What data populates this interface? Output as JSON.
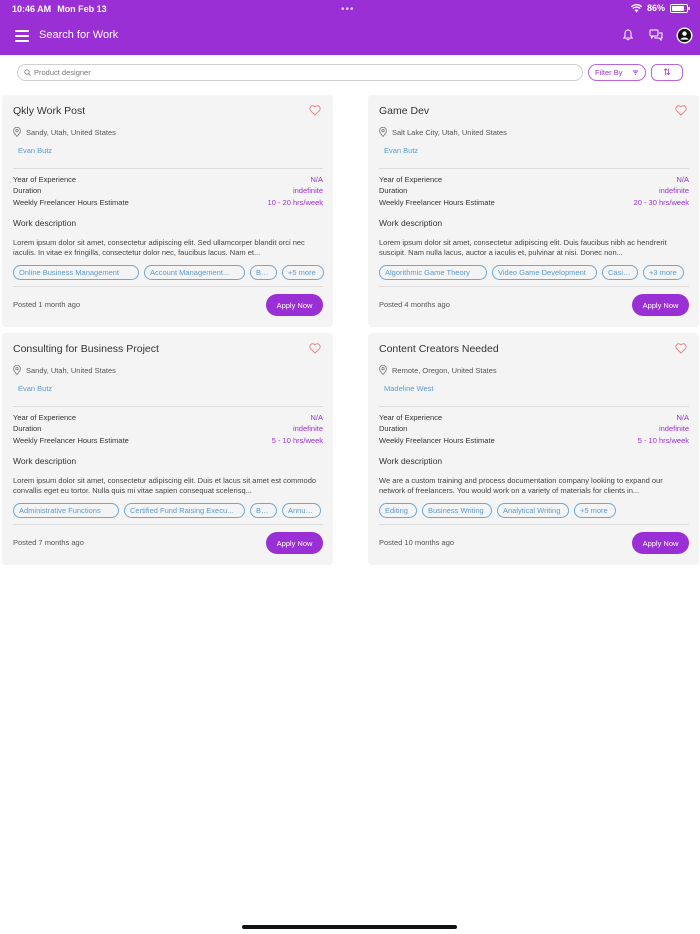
{
  "status_bar": {
    "time": "10:46 AM",
    "date": "Mon Feb 13",
    "battery": "86%"
  },
  "navbar": {
    "title": "Search for Work"
  },
  "search": {
    "placeholder": "Product designer",
    "filter_label": "Filter By",
    "sort_label": "⇅"
  },
  "colors": {
    "brand": "#9b2fd6",
    "link": "#5b9bd1",
    "card_bg": "#f4f4f4"
  },
  "labels": {
    "experience": "Year of Experience",
    "duration": "Duration",
    "hours": "Weekly Freelancer Hours Estimate",
    "work_description": "Work description",
    "apply": "Apply Now"
  },
  "jobs": [
    {
      "title": "Qkly Work Post",
      "location": "Sandy, Utah, United States",
      "poster": "Evan Butz",
      "experience": "N/A",
      "duration": "indefinite",
      "hours": "10 - 20 hrs/week",
      "description": "Lorem ipsum dolor sit amet, consectetur adipiscing elit. Sed ullamcorper blandit orci nec iaculis. In vitae ex fringilla, consectetur dolor nec, faucibus lacus. Nam et...",
      "tags": [
        "Online Business Management",
        "Account Management...",
        "Busi...",
        "+5 more"
      ],
      "posted": "Posted 1 month ago"
    },
    {
      "title": "Game Dev",
      "location": "Salt Lake City, Utah, United States",
      "poster": "Evan Butz",
      "experience": "N/A",
      "duration": "indefinite",
      "hours": "20 - 30 hrs/week",
      "description": "Lorem ipsum dolor sit amet, consectetur adipiscing elit. Duis faucibus nibh ac hendrerit suscipit. Nam nulla lacus, auctor a iaculis et, pulvinar at nisi. Donec non...",
      "tags": [
        "Algorithmic Game Theory",
        "Video Game Development",
        "Casino...",
        "+3 more"
      ],
      "posted": "Posted 4 months ago"
    },
    {
      "title": "Consulting for Business Project",
      "location": "Sandy, Utah, United States",
      "poster": "Evan Butz",
      "experience": "N/A",
      "duration": "indefinite",
      "hours": "5 - 10 hrs/week",
      "description": "Lorem ipsum dolor sit amet, consectetur adipiscing elit. Duis et lacus sit amet est commodo convallis eget eu tortor. Nulla quis mi vitae sapien consequat scelerisq...",
      "tags": [
        "Administrative Functions",
        "Certified Fund Raising Execu...",
        "Bon...",
        "Annual..."
      ],
      "posted": "Posted 7 months ago"
    },
    {
      "title": "Content Creators Needed",
      "location": "Remote, Oregon, United States",
      "poster": "Madeline West",
      "experience": "N/A",
      "duration": "indefinite",
      "hours": "5 - 10 hrs/week",
      "description": "We are a custom training and process documentation company looking to expand our network of freelancers. You would work on a variety of materials for clients in...",
      "tags": [
        "Editing",
        "Business Writing",
        "Analytical Writing",
        "+5 more"
      ],
      "posted": "Posted 10 months ago"
    }
  ]
}
